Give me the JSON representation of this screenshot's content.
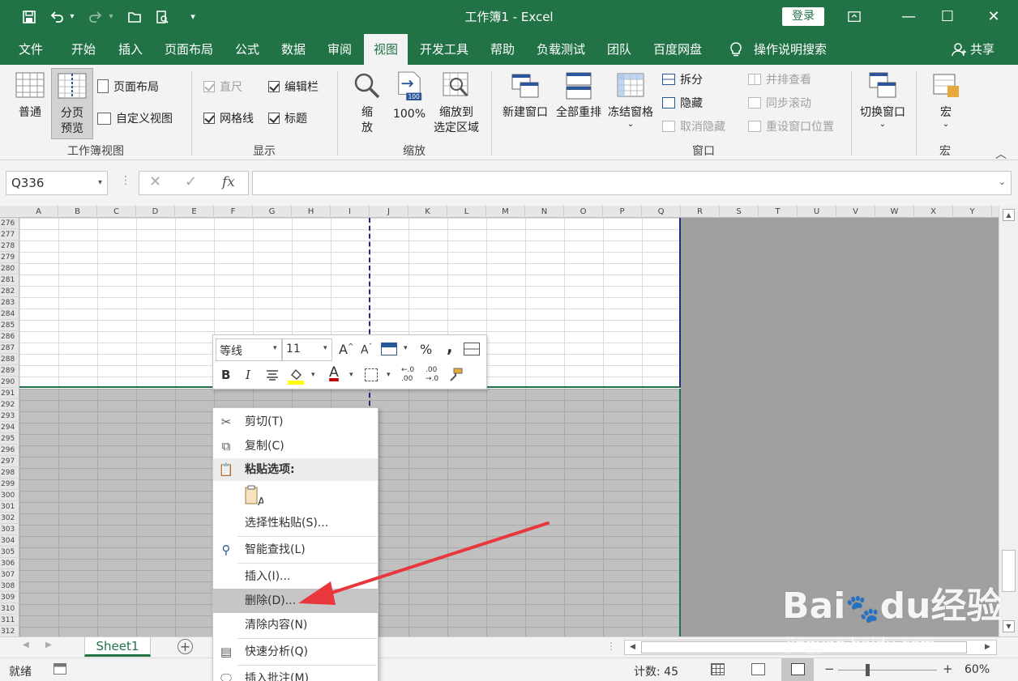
{
  "window": {
    "title": "工作簿1  -  Excel",
    "login": "登录"
  },
  "menu": [
    "文件",
    "开始",
    "插入",
    "页面布局",
    "公式",
    "数据",
    "审阅",
    "视图",
    "开发工具",
    "帮助",
    "负载测试",
    "团队",
    "百度网盘",
    "操作说明搜索"
  ],
  "share": "共享",
  "ribbon": {
    "workbook_views": {
      "label": "工作簿视图",
      "normal": "普通",
      "page_break_1": "分页",
      "page_break_2": "预览",
      "page_layout": "页面布局",
      "custom": "自定义视图"
    },
    "show": {
      "label": "显示",
      "ruler": "直尺",
      "formula_bar": "编辑栏",
      "gridlines": "网格线",
      "headings": "标题"
    },
    "zoom": {
      "label": "缩放",
      "zoom_1": "缩",
      "zoom_2": "放",
      "hundred": "100%",
      "hundred_icon": "100",
      "to_sel_1": "缩放到",
      "to_sel_2": "选定区域"
    },
    "window": {
      "label": "窗口",
      "new": "新建窗口",
      "arrange": "全部重排",
      "freeze": "冻结窗格",
      "split": "拆分",
      "hide": "隐藏",
      "unhide": "取消隐藏",
      "side_by_side": "并排查看",
      "sync_scroll": "同步滚动",
      "reset_pos": "重设窗口位置",
      "switch": "切换窗口"
    },
    "macros": {
      "label": "宏",
      "macro": "宏"
    }
  },
  "formula_bar": {
    "name_box": "Q336",
    "fx": "fx"
  },
  "columns": [
    "A",
    "B",
    "C",
    "D",
    "E",
    "F",
    "G",
    "H",
    "I",
    "J",
    "K",
    "L",
    "M",
    "N",
    "O",
    "P",
    "Q",
    "R",
    "S",
    "T",
    "U",
    "V",
    "W",
    "X",
    "Y"
  ],
  "rows": [
    "276",
    "277",
    "278",
    "279",
    "280",
    "281",
    "282",
    "283",
    "284",
    "285",
    "286",
    "287",
    "288",
    "289",
    "290",
    "291",
    "292",
    "293",
    "294",
    "295",
    "296",
    "297",
    "298",
    "299",
    "300",
    "301",
    "302",
    "303",
    "304",
    "305",
    "306",
    "307",
    "308",
    "309",
    "310",
    "311",
    "312"
  ],
  "mini_toolbar": {
    "font": "等线",
    "size": "11",
    "percent": "%",
    "comma": ",",
    "bold": "B",
    "italic": "I",
    "font_color": "A",
    "grow": "A",
    "shrink": "A",
    "dec_inc_a": "←.0",
    "dec_inc_b": ".00",
    "dec_dec_a": ".00",
    "dec_dec_b": "→.0"
  },
  "context_menu": {
    "cut": "剪切(T)",
    "copy": "复制(C)",
    "paste_options": "粘贴选项:",
    "paste_icon": "A",
    "paste_special": "选择性粘贴(S)...",
    "smart_lookup": "智能查找(L)",
    "insert": "插入(I)...",
    "delete": "删除(D)...",
    "clear": "清除内容(N)",
    "quick_analysis": "快速分析(Q)",
    "insert_comment": "插入批注(M)"
  },
  "sheet": {
    "name": "Sheet1",
    "add": "+"
  },
  "status": {
    "ready": "就绪",
    "count": "计数: 45",
    "zoom": "60%",
    "minus": "−",
    "plus": "+"
  },
  "colors": {
    "excel_green": "#217346",
    "arrow_red": "#e8383d"
  },
  "watermark": {
    "brand_a": "Bai",
    "brand_b": "du",
    "brand_c": "经验",
    "url": "jingyan.baidu.com"
  }
}
